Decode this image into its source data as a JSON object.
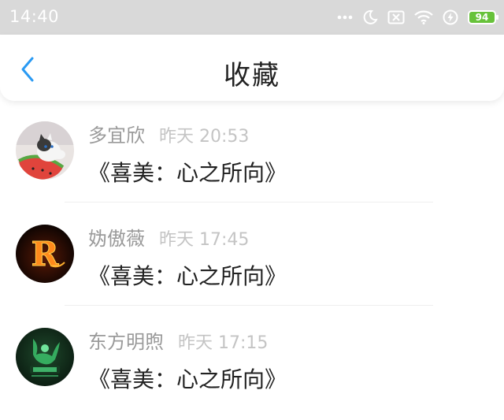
{
  "status_bar": {
    "time": "14:40",
    "battery_level": "94",
    "icons": [
      "more-dots-icon",
      "moon-icon",
      "sim-blocked-icon",
      "wifi-icon",
      "charging-icon",
      "battery-icon"
    ]
  },
  "nav": {
    "title": "收藏",
    "back_icon": "chevron-left-icon",
    "accent_color": "#2a9af3"
  },
  "favorites": [
    {
      "name": "多宜欣",
      "time": "昨天 20:53",
      "content": "《喜美：心之所向》",
      "avatar": "kitten-on-watermelon"
    },
    {
      "name": "妫傲薇",
      "time": "昨天 17:45",
      "content": "《喜美：心之所向》",
      "avatar": "fire-letter-r"
    },
    {
      "name": "东方明煦",
      "time": "昨天 17:15",
      "content": "《喜美：心之所向》",
      "avatar": "green-emblem"
    }
  ]
}
